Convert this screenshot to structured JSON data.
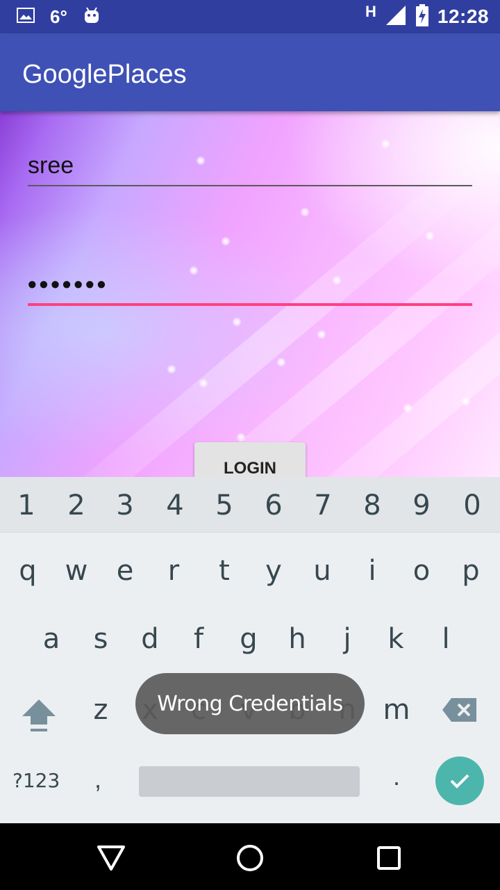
{
  "status_bar": {
    "left_icons": [
      "image-icon",
      "android-icon"
    ],
    "temperature": "6°",
    "network_type": "H",
    "time": "12:28",
    "right_icons": [
      "signal-icon",
      "battery-charging-icon"
    ]
  },
  "app_bar": {
    "title": "GooglePlaces"
  },
  "login_form": {
    "username_value": "sree",
    "password_value": "•••••••",
    "login_label": "LOGIN"
  },
  "keyboard": {
    "number_row": [
      "1",
      "2",
      "3",
      "4",
      "5",
      "6",
      "7",
      "8",
      "9",
      "0"
    ],
    "row_q": [
      "q",
      "w",
      "e",
      "r",
      "t",
      "y",
      "u",
      "i",
      "o",
      "p"
    ],
    "row_a": [
      "a",
      "s",
      "d",
      "f",
      "g",
      "h",
      "j",
      "k",
      "l"
    ],
    "row_z": [
      "z",
      "x",
      "c",
      "v",
      "b",
      "n",
      "m"
    ],
    "symbols_label": "?123",
    "comma": ",",
    "period": ".",
    "enter_color": "#4DB6AC"
  },
  "toast": {
    "message": "Wrong Credentials"
  },
  "colors": {
    "status_bar": "#303F9F",
    "primary": "#3F51B5",
    "accent": "#FF4081"
  }
}
